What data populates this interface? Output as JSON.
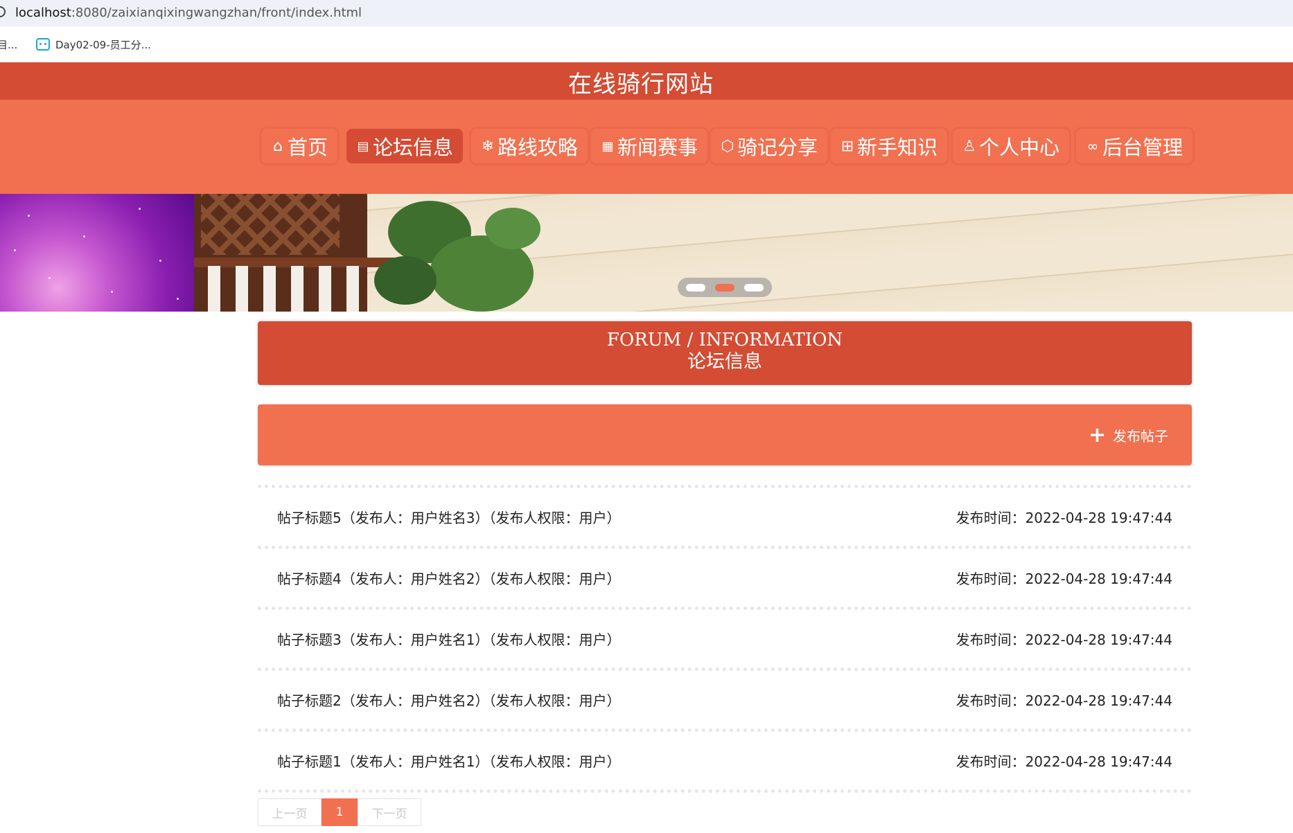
{
  "browser": {
    "url_host": "localhost",
    "url_path": ":8080/zaixianqixingwangzhan/front/index.html",
    "bookmark_truncated": "目...",
    "bookmark_label": "Day02-09-员工分..."
  },
  "site": {
    "title": "在线骑行网站"
  },
  "nav": {
    "items": [
      {
        "label": "首页",
        "icon": "home-icon",
        "glyph": "⌂"
      },
      {
        "label": "论坛信息",
        "icon": "clipboard-icon",
        "glyph": "📋"
      },
      {
        "label": "路线攻略",
        "icon": "snowflake-icon",
        "glyph": "❄"
      },
      {
        "label": "新闻赛事",
        "icon": "gift-icon",
        "glyph": "🎁"
      },
      {
        "label": "骑记分享",
        "icon": "cube-icon",
        "glyph": "⬡"
      },
      {
        "label": "新手知识",
        "icon": "apps-icon",
        "glyph": "⊞"
      },
      {
        "label": "个人中心",
        "icon": "user-icon",
        "glyph": "♙"
      },
      {
        "label": "后台管理",
        "icon": "link-icon",
        "glyph": "🔗"
      }
    ],
    "active_index": 1
  },
  "banner": {
    "slide_count": 3,
    "active_slide": 1
  },
  "section": {
    "title_en": "FORUM / INFORMATION",
    "title_cn": "论坛信息"
  },
  "actions": {
    "publish_label": "发布帖子"
  },
  "posts": [
    {
      "left": "帖子标题5（发布人：用户姓名3）（发布人权限：用户）",
      "right": "发布时间：2022-04-28 19:47:44"
    },
    {
      "left": "帖子标题4（发布人：用户姓名2）（发布人权限：用户）",
      "right": "发布时间：2022-04-28 19:47:44"
    },
    {
      "left": "帖子标题3（发布人：用户姓名1）（发布人权限：用户）",
      "right": "发布时间：2022-04-28 19:47:44"
    },
    {
      "left": "帖子标题2（发布人：用户姓名2）（发布人权限：用户）",
      "right": "发布时间：2022-04-28 19:47:44"
    },
    {
      "left": "帖子标题1（发布人：用户姓名1）（发布人权限：用户）",
      "right": "发布时间：2022-04-28 19:47:44"
    }
  ],
  "pagination": {
    "prev_label": "上一页",
    "current_page": "1",
    "next_label": "下一页"
  },
  "colors": {
    "primary_dark": "#d34c33",
    "primary": "#f07050"
  }
}
